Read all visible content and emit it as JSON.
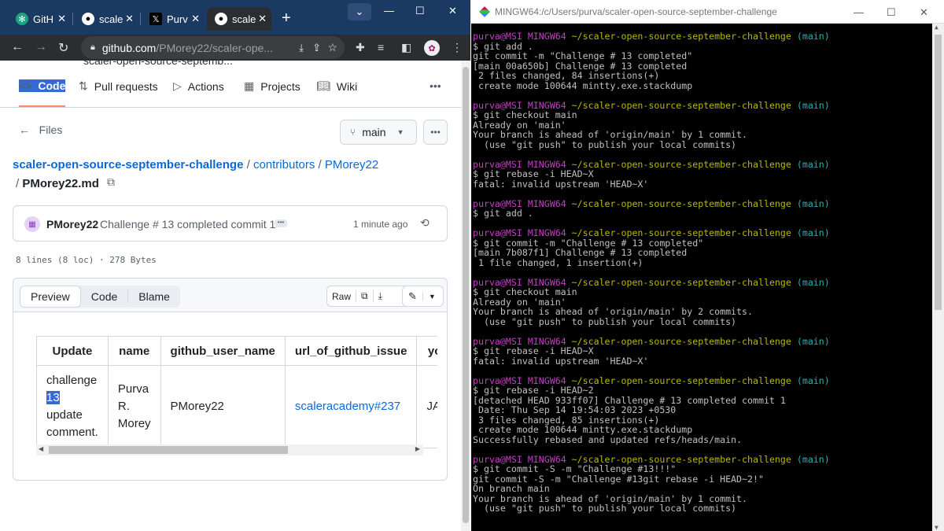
{
  "browser": {
    "tabs": [
      {
        "label": "GitH",
        "icon": "chatgpt-icon"
      },
      {
        "label": "scale",
        "icon": "github-icon"
      },
      {
        "label": "Purv",
        "icon": "x-icon"
      },
      {
        "label": "scale",
        "icon": "github-icon",
        "active": true
      }
    ],
    "url_host": "github.com",
    "url_path": "/PMorey22/scaler-ope..."
  },
  "github": {
    "peek_text": "scaler-open-source-septemb...",
    "nav": [
      "Code",
      "Pull requests",
      "Actions",
      "Projects",
      "Wiki"
    ],
    "files_label": "Files",
    "branch": "main",
    "breadcrumb": [
      "scaler-open-source-september-challenge",
      "contributors",
      "PMorey22"
    ],
    "filename": "PMorey22.md",
    "commit": {
      "user": "PMorey22",
      "message": "Challenge # 13 completed commit 1",
      "time": "1 minute ago"
    },
    "meta": "8 lines (8 loc) · 278 Bytes",
    "view_tabs": [
      "Preview",
      "Code",
      "Blame"
    ],
    "raw_label": "Raw",
    "table": {
      "headers": [
        "Update",
        "name",
        "github_user_name",
        "url_of_github_issue",
        "yo"
      ],
      "row": {
        "update_1": "challenge",
        "update_sel": "13",
        "update_2": "update",
        "update_3": "comment.",
        "name": "Purva R. Morey",
        "github_user_name": "PMorey22",
        "url_of_github_issue": "scaleracademy#237",
        "yo": "JA'"
      }
    }
  },
  "terminal": {
    "title": "MINGW64:/c/Users/purva/scaler-open-source-september-challenge",
    "prompt_user": "purva@MSI",
    "prompt_sys": "MINGW64",
    "prompt_path": "~/scaler-open-source-september-challenge",
    "prompt_branch": "(main)",
    "blocks": [
      {
        "cmd": "$ git add .",
        "out": [
          "git commit -m \"Challenge # 13 completed\"",
          "[main 00a650b] Challenge # 13 completed",
          " 2 files changed, 84 insertions(+)",
          " create mode 100644 mintty.exe.stackdump"
        ]
      },
      {
        "cmd": "$ git checkout main",
        "out": [
          "Already on 'main'",
          "Your branch is ahead of 'origin/main' by 1 commit.",
          "  (use \"git push\" to publish your local commits)"
        ]
      },
      {
        "cmd": "$ git rebase -i HEAD~X",
        "out": [
          "fatal: invalid upstream 'HEAD~X'"
        ]
      },
      {
        "cmd": "$ git add .",
        "out": []
      },
      {
        "cmd": "$ git commit -m \"Challenge # 13 completed\"",
        "out": [
          "[main 7b087f1] Challenge # 13 completed",
          " 1 file changed, 1 insertion(+)"
        ]
      },
      {
        "cmd": "$ git checkout main",
        "out": [
          "Already on 'main'",
          "Your branch is ahead of 'origin/main' by 2 commits.",
          "  (use \"git push\" to publish your local commits)"
        ]
      },
      {
        "cmd": "$ git rebase -i HEAD~X",
        "out": [
          "fatal: invalid upstream 'HEAD~X'"
        ]
      },
      {
        "cmd": "$ git rebase -i HEAD~2",
        "out": [
          "[detached HEAD 933ff07] Challenge # 13 completed commit 1",
          " Date: Thu Sep 14 19:54:03 2023 +0530",
          " 3 files changed, 85 insertions(+)",
          " create mode 100644 mintty.exe.stackdump",
          "Successfully rebased and updated refs/heads/main."
        ]
      },
      {
        "cmd": "$ git commit -S -m \"Challenge #13!!!\"",
        "out": [
          "git commit -S -m \"Challenge #13git rebase -i HEAD~2!\"",
          "On branch main",
          "Your branch is ahead of 'origin/main' by 1 commit.",
          "  (use \"git push\" to publish your local commits)"
        ]
      }
    ]
  }
}
